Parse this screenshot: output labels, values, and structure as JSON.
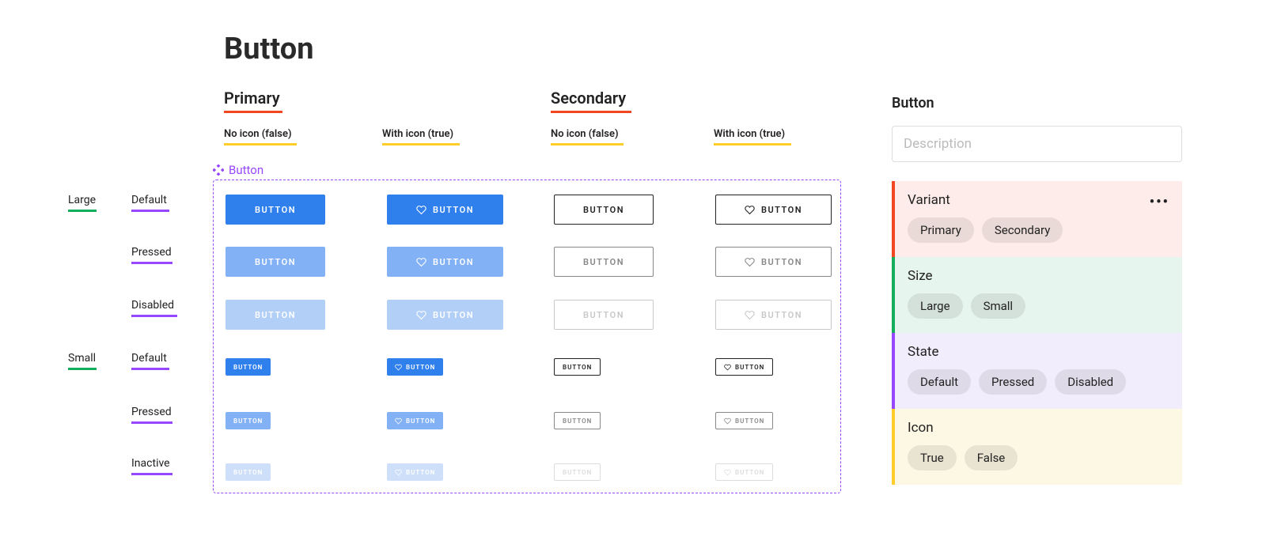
{
  "page_title": "Button",
  "variants": {
    "primary": {
      "label": "Primary",
      "sub_no_icon": "No icon (false)",
      "sub_with_icon": "With icon (true)"
    },
    "secondary": {
      "label": "Secondary",
      "sub_no_icon": "No icon (false)",
      "sub_with_icon": "With icon (true)"
    }
  },
  "sizes": {
    "large": "Large",
    "small": "Small"
  },
  "states": {
    "default": "Default",
    "pressed": "Pressed",
    "disabled": "Disabled",
    "inactive": "Inactive"
  },
  "component_label": "Button",
  "button_text": "BUTTON",
  "panel": {
    "title": "Button",
    "description_placeholder": "Description",
    "groups": {
      "variant": {
        "title": "Variant",
        "options": [
          "Primary",
          "Secondary"
        ]
      },
      "size": {
        "title": "Size",
        "options": [
          "Large",
          "Small"
        ]
      },
      "state": {
        "title": "State",
        "options": [
          "Default",
          "Pressed",
          "Disabled"
        ]
      },
      "icon": {
        "title": "Icon",
        "options": [
          "True",
          "False"
        ]
      }
    }
  }
}
